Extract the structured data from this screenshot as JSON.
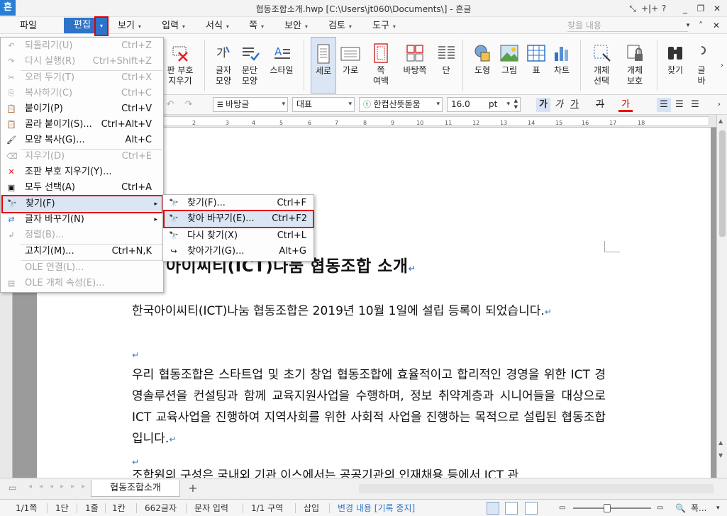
{
  "titlebar": {
    "logo": "흔",
    "title": "협동조합소개.hwp [C:\\Users\\jt060\\Documents\\] - 흔글",
    "controls": [
      "⤡",
      "+|+",
      "?",
      "_",
      "❐",
      "✕"
    ]
  },
  "menubar": {
    "file": "파일",
    "edit": "편집",
    "items": [
      "보기",
      "입력",
      "서식",
      "쪽",
      "보안",
      "검토",
      "도구"
    ],
    "search_placeholder": "찾을 내용"
  },
  "ribbon": {
    "buttons": [
      {
        "label": "판 부호\n지우기"
      },
      {
        "label": "글자\n모양"
      },
      {
        "label": "문단\n모양"
      },
      {
        "label": "스타일"
      },
      {
        "label": "세로"
      },
      {
        "label": "가로"
      },
      {
        "label": "쪽\n여백"
      },
      {
        "label": "바탕쪽"
      },
      {
        "label": "단"
      },
      {
        "label": "도형"
      },
      {
        "label": "그림"
      },
      {
        "label": "표"
      },
      {
        "label": "차트"
      },
      {
        "label": "개체\n선택"
      },
      {
        "label": "개체\n보호"
      },
      {
        "label": "찾기"
      },
      {
        "label": "글\n바"
      }
    ]
  },
  "formatbar": {
    "style": "바탕글",
    "lang": "대표",
    "font": "한컴산뜻돋움",
    "size": "16.0",
    "unit": "pt",
    "bold": "가",
    "italic": "가",
    "underline": "가",
    "strike": "가",
    "color": "가"
  },
  "ruler": {
    "ticks": [
      "2",
      "3",
      "4",
      "5",
      "6",
      "7",
      "8",
      "9",
      "10",
      "11",
      "12",
      "13",
      "14",
      "15",
      "16",
      "17",
      "18"
    ]
  },
  "edit_menu": {
    "items": [
      {
        "icon": "↶",
        "label": "되돌리기(U)",
        "shortcut": "Ctrl+Z",
        "disabled": true
      },
      {
        "icon": "↷",
        "label": "다시 실행(R)",
        "shortcut": "Ctrl+Shift+Z",
        "disabled": true
      },
      {
        "icon": "✂",
        "label": "오려 두기(T)",
        "shortcut": "Ctrl+X",
        "disabled": true
      },
      {
        "icon": "⎘",
        "label": "복사하기(C)",
        "shortcut": "Ctrl+C",
        "disabled": true
      },
      {
        "icon": "📋",
        "label": "붙이기(P)",
        "shortcut": "Ctrl+V",
        "disabled": false
      },
      {
        "icon": "📋",
        "label": "골라 붙이기(S)...",
        "shortcut": "Ctrl+Alt+V",
        "disabled": false
      },
      {
        "icon": "🖌",
        "label": "모양 복사(G)...",
        "shortcut": "Alt+C",
        "disabled": false
      },
      {
        "icon": "⌫",
        "label": "지우기(D)",
        "shortcut": "Ctrl+E",
        "disabled": true
      },
      {
        "icon": "✕",
        "label": "조판 부호 지우기(Y)...",
        "shortcut": "",
        "disabled": false
      },
      {
        "icon": "▣",
        "label": "모두 선택(A)",
        "shortcut": "Ctrl+A",
        "disabled": false
      },
      {
        "icon": "🔭",
        "label": "찾기(F)",
        "shortcut": "",
        "disabled": false
      },
      {
        "icon": "⇄",
        "label": "글자 바꾸기(N)",
        "shortcut": "",
        "disabled": false
      },
      {
        "icon": "↲",
        "label": "정렬(B)...",
        "shortcut": "",
        "disabled": true
      },
      {
        "icon": "",
        "label": "고치기(M)...",
        "shortcut": "Ctrl+N,K",
        "disabled": false
      },
      {
        "icon": "",
        "label": "OLE 연결(L)...",
        "shortcut": "",
        "disabled": true
      },
      {
        "icon": "▤",
        "label": "OLE 개체 속성(E)...",
        "shortcut": "",
        "disabled": true
      }
    ]
  },
  "find_submenu": {
    "items": [
      {
        "icon": "🔭",
        "label": "찾기(F)...",
        "shortcut": "Ctrl+F"
      },
      {
        "icon": "🔭",
        "label": "찾아 바꾸기(E)...",
        "shortcut": "Ctrl+F2"
      },
      {
        "icon": "🔭",
        "label": "다시 찾기(X)",
        "shortcut": "Ctrl+L"
      },
      {
        "icon": "↪",
        "label": "찾아가기(G)...",
        "shortcut": "Alt+G"
      }
    ]
  },
  "document": {
    "title": "아이씨티(ICT)나눔 협동조합 소개",
    "p1": "한국아이씨티(ICT)나눔 협동조합은 2019년 10월 1일에 설립 등록이 되었습니다.",
    "p2": "우리 협동조합은 스타트업 및 초기 창업 협동조합에 효율적이고 합리적인 경영을 위한 ICT 경영솔루션을 컨설팅과 함께 교육지원사업을 수행하며, 정보 취약계층과 시니어들을 대상으로 ICT 교육사업을 진행하여 지역사회를 위한 사회적 사업을 진행하는 목적으로 설립된 협동조합입니다.",
    "p3_partial": "조합원의 구성은 국내외 기관 이스에서는 공공기관의 인재채용 등에서 ICT 관"
  },
  "tabbar": {
    "doc_tab": "협동조합소개",
    "add": "+"
  },
  "statusbar": {
    "page": "1/1쪽",
    "column": "1단",
    "line": "1줄",
    "col": "1칸",
    "chars": "662글자",
    "mode": "문자 입력",
    "section": "1/1 구역",
    "insert": "삽입",
    "track": "변경 내용 [기록 중지]",
    "zoom": "폭..."
  },
  "colors": {
    "accent": "#2f73c8",
    "highlight_border": "#e00000",
    "menu_highlight": "#dbe6f5"
  }
}
